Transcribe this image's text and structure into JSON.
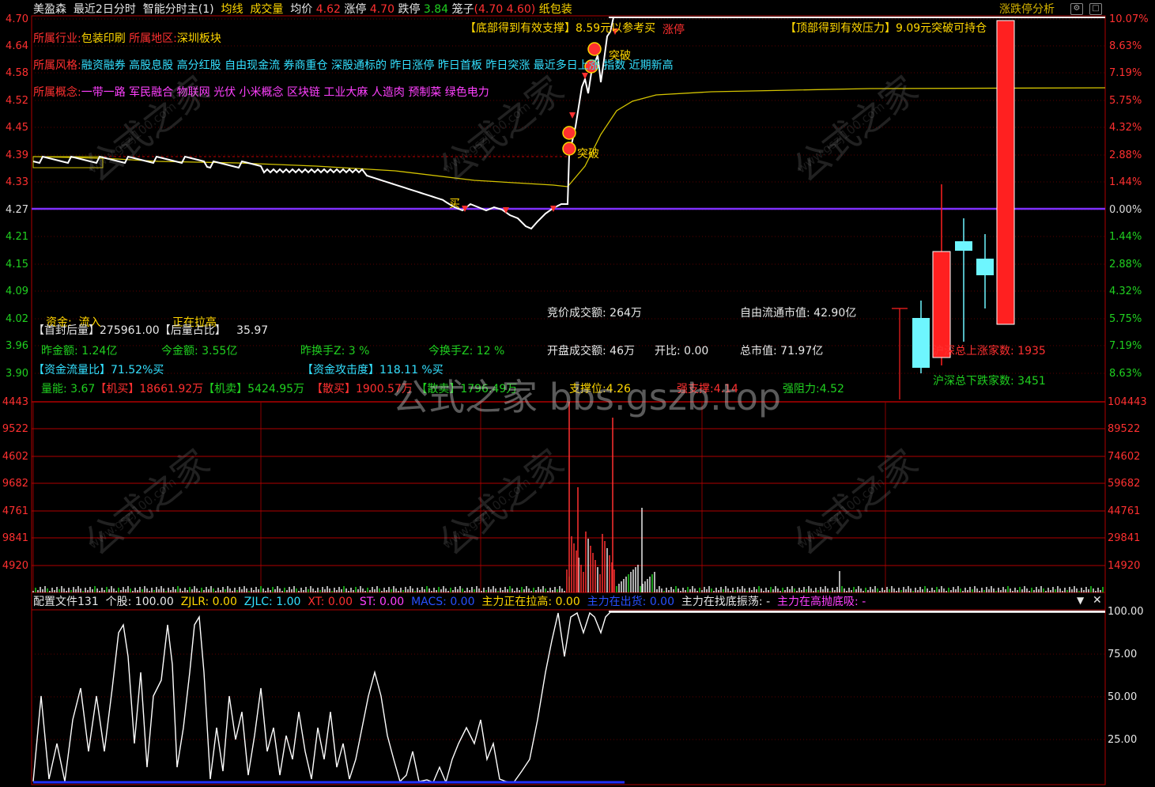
{
  "header": {
    "stock_name": "美盈森",
    "mode": "最近2日分时",
    "indicator": "智能分时主(1)",
    "avg_line_label": "均线",
    "volume_label": "成交量",
    "avg_price_label": "均价",
    "avg_price": "4.62",
    "limit_up_label": "涨停",
    "limit_up": "4.70",
    "limit_down_label": "跌停",
    "limit_down": "3.84",
    "cage_label": "笼子",
    "cage_value": "(4.70 4.60)",
    "sector_tag": "纸包装",
    "right_title": "涨跌停分析"
  },
  "info": {
    "industry_label": "所属行业:",
    "industry": "包装印刷",
    "region_label": "所属地区:",
    "region": "深圳板块",
    "style_label": "所属风格:",
    "style": "融资融券 高股息股 高分红股 自由现金流 券商重仓 深股通标的 昨日涨停 昨日首板 昨日突涨 最近多日上涨 指数 近期新高",
    "concept_label": "所属概念:",
    "concept": "一带一路 军民融合 物联网 光伏 小米概念 区块链 工业大麻 人造肉 预制菜 绿色电力"
  },
  "signals": {
    "bottom_support": "【底部得到有效支撑】8.59元以参考买",
    "top_pressure": "【顶部得到有效压力】9.09元突破可持仓",
    "limit_up_text": "涨停",
    "breakout1": "突破",
    "breakout2": "突破",
    "buy_marker": "买"
  },
  "y_axis_left": [
    "4.70",
    "4.64",
    "4.58",
    "4.52",
    "4.45",
    "4.39",
    "4.33",
    "4.27",
    "4.21",
    "4.15",
    "4.09",
    "4.02",
    "3.96",
    "3.90"
  ],
  "y_axis_right": [
    "10.07%",
    "8.63%",
    "7.19%",
    "5.75%",
    "4.32%",
    "2.88%",
    "1.44%",
    "0.00%",
    "1.44%",
    "2.88%",
    "4.32%",
    "5.75%",
    "7.19%",
    "8.63%"
  ],
  "vol_axis_left": [
    "4443",
    "9522",
    "4602",
    "9682",
    "4761",
    "9841",
    "4920"
  ],
  "vol_axis_right": [
    "104443",
    "89522",
    "74602",
    "59682",
    "44761",
    "29841",
    "14920"
  ],
  "osc_axis_right": [
    "100.00",
    "75.00",
    "50.00",
    "25.00"
  ],
  "stats": {
    "fund_label": "资金:",
    "fund_value": "流入",
    "pulling": "正在拉高",
    "seal_after": "【首封后量】",
    "seal_after_value": "275961.00",
    "seal_ratio": "【后量占比】",
    "seal_ratio_value": "35.97",
    "prev_amount": "昨金额: 1.24亿",
    "today_amount": "今金额: 3.55亿",
    "prev_turnover": "昨换手Z: 3 %",
    "today_turnover": "今换手Z: 12 %",
    "flow_ratio": "【资金流量比】71.52%买",
    "attack": "【资金攻击度】118.11 %买",
    "vol_energy": "量能: 3.67",
    "inst_buy": "【机买】18661.92万",
    "inst_sell": "【机卖】5424.95万",
    "retail_buy": "【散买】1900.57万",
    "retail_sell": "【散卖】1796.49万",
    "support": "支撑位:4.26",
    "strong_support": "强支撑:4.14",
    "strong_resist": "强阻力:4.52",
    "auction_amount": "竞价成交额: 264万",
    "open_amount": "开盘成交额: 46万",
    "open_ratio": "开比: 0.00",
    "float_mcap": "自由流通市值: 42.90亿",
    "total_mcap": "总市值: 71.97亿",
    "up_count": "沪深总上涨家数: 1935",
    "down_count": "沪深总下跌家数: 3451"
  },
  "osc_header": {
    "config": "配置文件131",
    "stock": "个股: 100.00",
    "zjlr": "ZJLR: 0.00",
    "zjlc": "ZJLC: 1.00",
    "xt": "XT: 0.00",
    "st": "ST: 0.00",
    "macs": "MACS: 0.00",
    "pulling": "主力正在拉高: 0.00",
    "selling": "主力在出货: 0.00",
    "bottoming": "主力在找底振荡: -",
    "high_absorb": "主力在高抛底吸: -"
  },
  "watermark": {
    "big": "公式之家 bbs.gszb.top",
    "small1": "公式之家",
    "small2": "www.gszj100.com"
  },
  "colors": {
    "price_line": "#ffffff",
    "avg_line": "#d4c400",
    "zero_line": "#7f30ff",
    "grid": "#b00000",
    "up": "#ff2020",
    "down": "#6ef6ff"
  }
}
